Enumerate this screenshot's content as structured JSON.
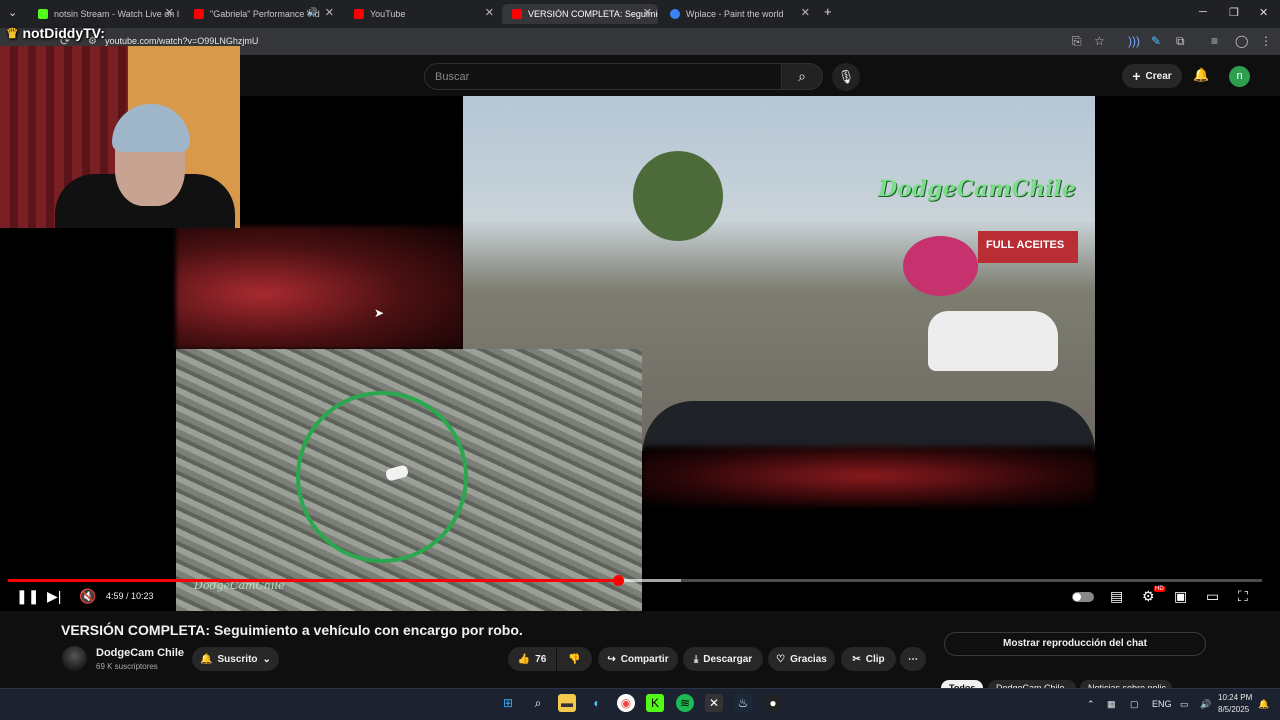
{
  "browser": {
    "tabs": [
      {
        "label": "notsin Stream - Watch Live on I",
        "favicon_color": "#53fc18"
      },
      {
        "label": "\"Gabriela\" Performance Vid",
        "favicon_color": "#ff0000"
      },
      {
        "label": "YouTube",
        "favicon_color": "#ff0000"
      },
      {
        "label": "VERSIÓN COMPLETA: Seguimie",
        "favicon_color": "#ff0000"
      },
      {
        "label": "Wplace - Paint the world",
        "favicon_color": "#3b82f6"
      }
    ],
    "url": "youtube.com/watch?v=O99LNGhzjmU"
  },
  "youtube": {
    "search_placeholder": "Buscar",
    "create_label": "Crear",
    "avatar_letter": "n"
  },
  "stream_overlay": {
    "streamer_name": "notDiddyTV:"
  },
  "video": {
    "watermark": "DodgeCamChile",
    "sign_text": "FULL ACEITES",
    "progress": {
      "elapsed_fraction": 0.4862,
      "buffered_fraction": 0.537
    },
    "time_display": "4:59 / 10:23",
    "hd_badge": "HD"
  },
  "info": {
    "title": "VERSIÓN COMPLETA: Seguimiento a vehículo con encargo por robo.",
    "channel_name": "DodgeCam Chile",
    "subscribers": "69 K suscriptores",
    "subscribed_label": "Suscrito",
    "likes": "76",
    "share_label": "Compartir",
    "download_label": "Descargar",
    "thanks_label": "Gracias",
    "clip_label": "Clip",
    "chat_replay_label": "Mostrar reproducción del chat",
    "chips": [
      "Todos",
      "DodgeCam Chile",
      "Noticias sobre polic"
    ]
  },
  "taskbar": {
    "language": "ENG",
    "time": "10:24 PM",
    "date": "8/5/2025"
  },
  "colors": {
    "accent_red": "#ff0000",
    "bg_dark": "#0f0f0f",
    "avatar_green": "#2e9e4f"
  }
}
